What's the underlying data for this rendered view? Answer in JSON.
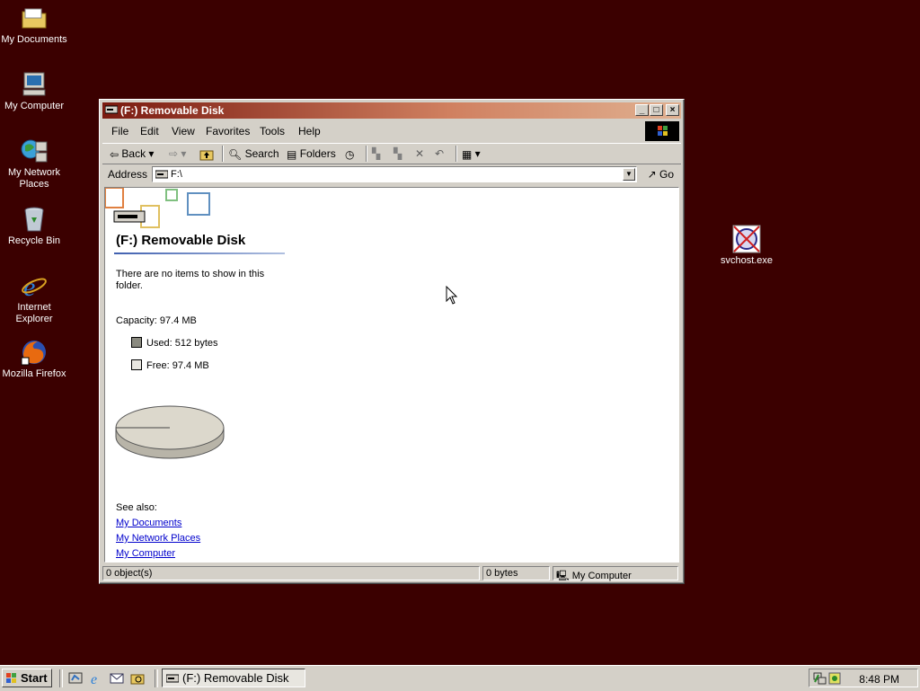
{
  "desktop": {
    "icons": [
      {
        "label": "My Documents"
      },
      {
        "label": "My Computer"
      },
      {
        "label": "My Network Places"
      },
      {
        "label": "Recycle Bin"
      },
      {
        "label": "Internet Explorer"
      },
      {
        "label": "Mozilla Firefox"
      },
      {
        "label": "svchost.exe"
      }
    ]
  },
  "window": {
    "title": "(F:) Removable Disk",
    "menu": [
      "File",
      "Edit",
      "View",
      "Favorites",
      "Tools",
      "Help"
    ],
    "toolbar": {
      "back": "Back",
      "search": "Search",
      "folders": "Folders"
    },
    "address": {
      "label": "Address",
      "value": "F:\\",
      "go": "Go"
    },
    "content": {
      "folder_title": "(F:) Removable Disk",
      "empty_msg": "There are no items to show in this folder.",
      "capacity": "Capacity: 97.4 MB",
      "used": "Used: 512 bytes",
      "free": "Free: 97.4 MB",
      "see_also": "See also:",
      "links": [
        "My Documents",
        "My Network Places",
        "My Computer"
      ]
    },
    "status": {
      "objects": "0 object(s)",
      "size": "0 bytes",
      "zone": "My Computer"
    }
  },
  "taskbar": {
    "start": "Start",
    "task": "(F:) Removable Disk",
    "clock": "8:48 PM"
  },
  "colors": {
    "desktop": "#3b0000",
    "title_active": "#7a1a10",
    "link": "#0000cc"
  }
}
